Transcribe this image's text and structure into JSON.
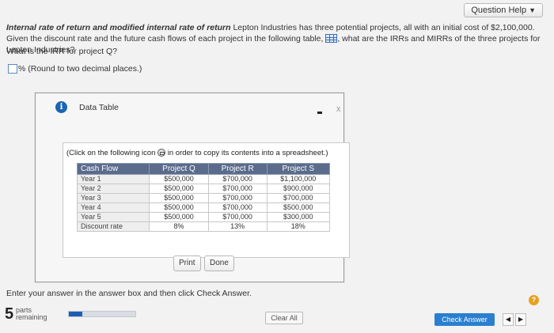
{
  "header": {
    "help_button": "Question Help",
    "help_caret": "▼"
  },
  "question": {
    "title": "Internal rate of return and modified internal rate of return",
    "body_part1": " Lepton Industries has three potential projects, all with an initial cost of $2,100,000. Given the discount rate and the future cash flows of each project in the following table,",
    "body_part2": ", what are the IRRs and MIRRs of the three projects for Lepton Industries?",
    "table_icon": "table-icon"
  },
  "subquestion": "What is the IRR for project Q?",
  "answer": {
    "value": "",
    "suffix": "% (Round to two decimal places.)"
  },
  "dialog": {
    "title": "Data Table",
    "info_icon": "info-icon",
    "close_glyph": "x",
    "copy_note_pre": "(Click on the following icon",
    "copy_note_post": " in order to copy its contents into a spreadsheet.)",
    "table": {
      "headers": [
        "Cash Flow",
        "Project Q",
        "Project R",
        "Project S"
      ],
      "rows": [
        [
          "Year 1",
          "$500,000",
          "$700,000",
          "$1,100,000"
        ],
        [
          "Year 2",
          "$500,000",
          "$700,000",
          "$900,000"
        ],
        [
          "Year 3",
          "$500,000",
          "$700,000",
          "$700,000"
        ],
        [
          "Year 4",
          "$500,000",
          "$700,000",
          "$500,000"
        ],
        [
          "Year 5",
          "$500,000",
          "$700,000",
          "$300,000"
        ],
        [
          "Discount rate",
          "8%",
          "13%",
          "18%"
        ]
      ]
    },
    "print_label": "Print",
    "done_label": "Done"
  },
  "instruction": "Enter your answer in the answer box and then click Check Answer.",
  "help_badge": "?",
  "footer": {
    "parts_count": "5",
    "parts_line1": "parts",
    "parts_line2": "remaining",
    "progress_fraction": 0.2,
    "clear_label": "Clear All",
    "check_label": "Check Answer",
    "prev_glyph": "◀",
    "next_glyph": "▶"
  }
}
